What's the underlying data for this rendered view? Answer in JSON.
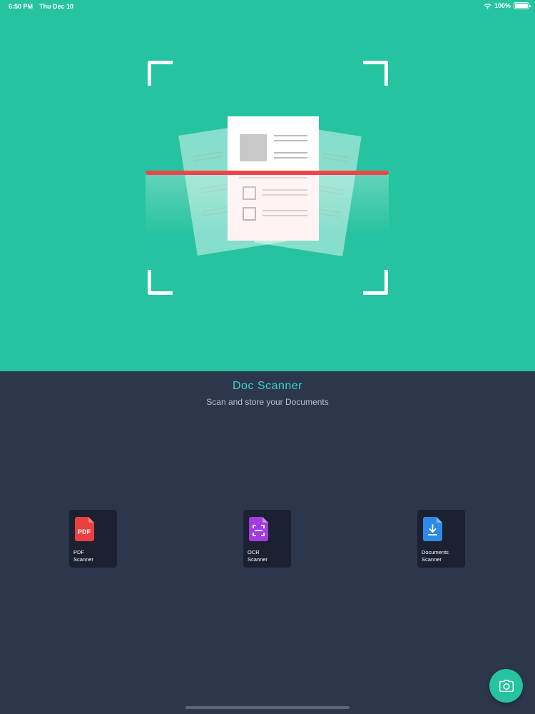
{
  "status_bar": {
    "time": "6:50 PM",
    "date": "Thu Dec 10",
    "battery": "100%"
  },
  "app": {
    "title": "Doc Scanner",
    "subtitle": "Scan and store your Documents"
  },
  "tiles": [
    {
      "line1": "PDF",
      "line2": "Scanner",
      "icon": "pdf-file-icon",
      "icon_text": "PDF",
      "color": "#e8403f"
    },
    {
      "line1": "OCR",
      "line2": "Scanner",
      "icon": "ocr-file-icon",
      "color": "#a23ce0"
    },
    {
      "line1": "Documents",
      "line2": "Scanner",
      "icon": "download-file-icon",
      "color": "#2f8ae6"
    }
  ],
  "colors": {
    "accent": "#26c3a0",
    "background": "#2c374e",
    "scan_line": "#f0444a",
    "title": "#3ed3c7"
  },
  "fab": {
    "icon": "camera-icon"
  }
}
